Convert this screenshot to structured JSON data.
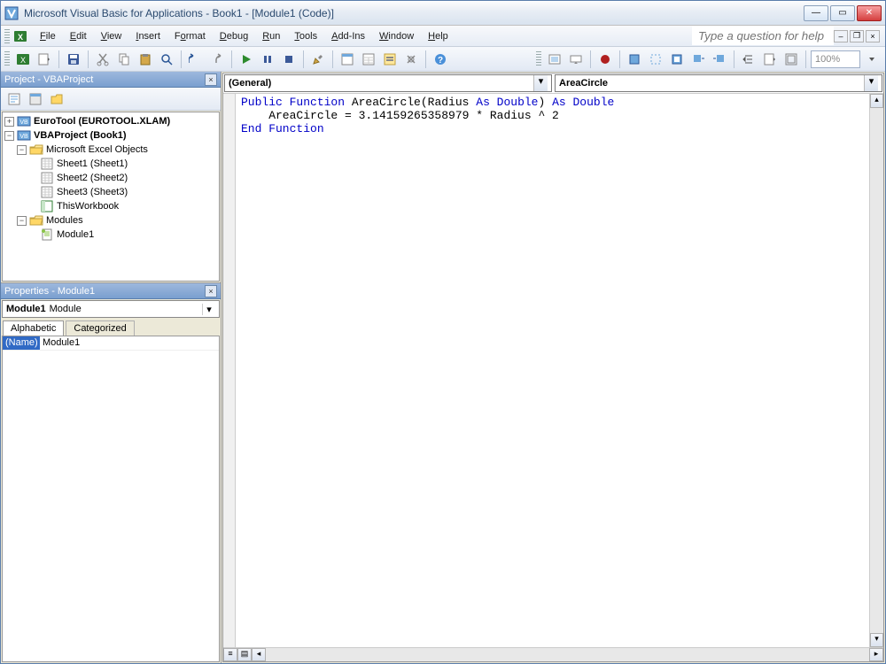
{
  "title": "Microsoft Visual Basic for Applications - Book1 - [Module1 (Code)]",
  "menu": {
    "file": "File",
    "edit": "Edit",
    "view": "View",
    "insert": "Insert",
    "format": "Format",
    "debug": "Debug",
    "run": "Run",
    "tools": "Tools",
    "addins": "Add-Ins",
    "window": "Window",
    "help": "Help"
  },
  "help_placeholder": "Type a question for help",
  "zoom": "100%",
  "project_pane_title": "Project - VBAProject",
  "tree": {
    "eurotool": "EuroTool (EUROTOOL.XLAM)",
    "vbaproject": "VBAProject (Book1)",
    "excel_objects": "Microsoft Excel Objects",
    "sheet1": "Sheet1 (Sheet1)",
    "sheet2": "Sheet2 (Sheet2)",
    "sheet3": "Sheet3 (Sheet3)",
    "thiswb": "ThisWorkbook",
    "modules": "Modules",
    "module1": "Module1"
  },
  "props_pane_title": "Properties - Module1",
  "props_object_name": "Module1",
  "props_object_type": "Module",
  "props_tabs": {
    "alpha": "Alphabetic",
    "cat": "Categorized"
  },
  "props_row": {
    "name_label": "(Name)",
    "name_value": "Module1"
  },
  "code_object": "(General)",
  "code_proc": "AreaCircle",
  "code": {
    "l1a": "Public Function",
    "l1b": " AreaCircle(Radius ",
    "l1c": "As Double",
    "l1d": ") ",
    "l1e": "As Double",
    "l2": "    AreaCircle = 3.14159265358979 * Radius ^ 2",
    "l3": "End Function"
  }
}
